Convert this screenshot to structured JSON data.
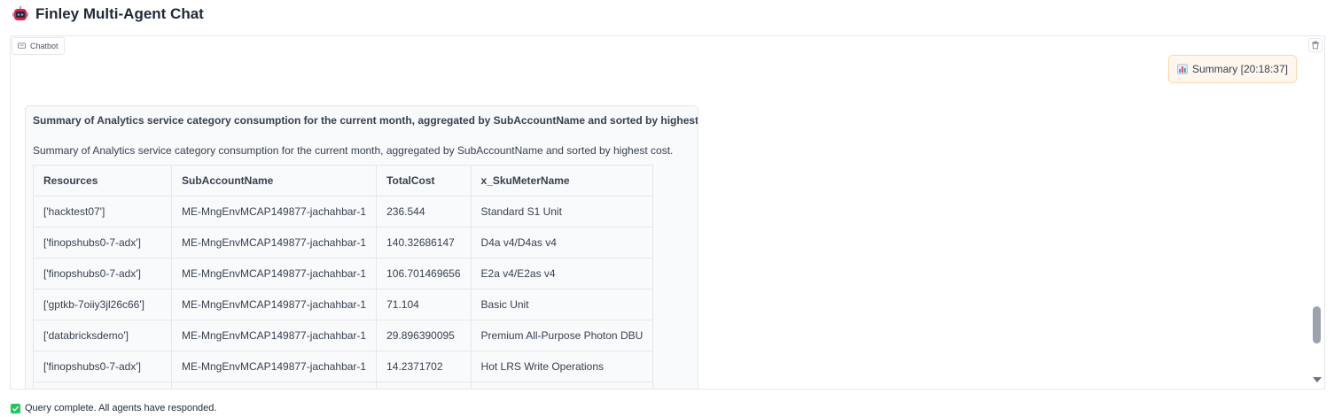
{
  "app": {
    "title": "Finley Multi-Agent Chat"
  },
  "chatbot": {
    "label": "Chatbot",
    "user_message": "Summary [20:18:37]",
    "bot_message": {
      "heading": "Summary of Analytics service category consumption for the current month, aggregated by SubAccountName and sorted by highest cost.",
      "description": "Summary of Analytics service category consumption for the current month, aggregated by SubAccountName and sorted by highest cost.",
      "table": {
        "headers": [
          "Resources",
          "SubAccountName",
          "TotalCost",
          "x_SkuMeterName"
        ],
        "rows": [
          [
            "['hacktest07']",
            "ME-MngEnvMCAP149877-jachahbar-1",
            "236.544",
            "Standard S1 Unit"
          ],
          [
            "['finopshubs0-7-adx']",
            "ME-MngEnvMCAP149877-jachahbar-1",
            "140.32686147",
            "D4a v4/D4as v4"
          ],
          [
            "['finopshubs0-7-adx']",
            "ME-MngEnvMCAP149877-jachahbar-1",
            "106.701469656",
            "E2a v4/E2as v4"
          ],
          [
            "['gptkb-7oiiy3jl26c66']",
            "ME-MngEnvMCAP149877-jachahbar-1",
            "71.104",
            "Basic Unit"
          ],
          [
            "['databricksdemo']",
            "ME-MngEnvMCAP149877-jachahbar-1",
            "29.896390095",
            "Premium All-Purpose Photon DBU"
          ],
          [
            "['finopshubs0-7-adx']",
            "ME-MngEnvMCAP149877-jachahbar-1",
            "14.2371702",
            "Hot LRS Write Operations"
          ]
        ]
      }
    }
  },
  "status": {
    "text": "Query complete. All agents have responded.",
    "color": "#22c55e"
  },
  "icons": {
    "title": "robot-icon",
    "label": "chat-icon",
    "clear": "trash-icon",
    "user": "bar-chart-icon",
    "status": "checkbox-check-icon"
  }
}
